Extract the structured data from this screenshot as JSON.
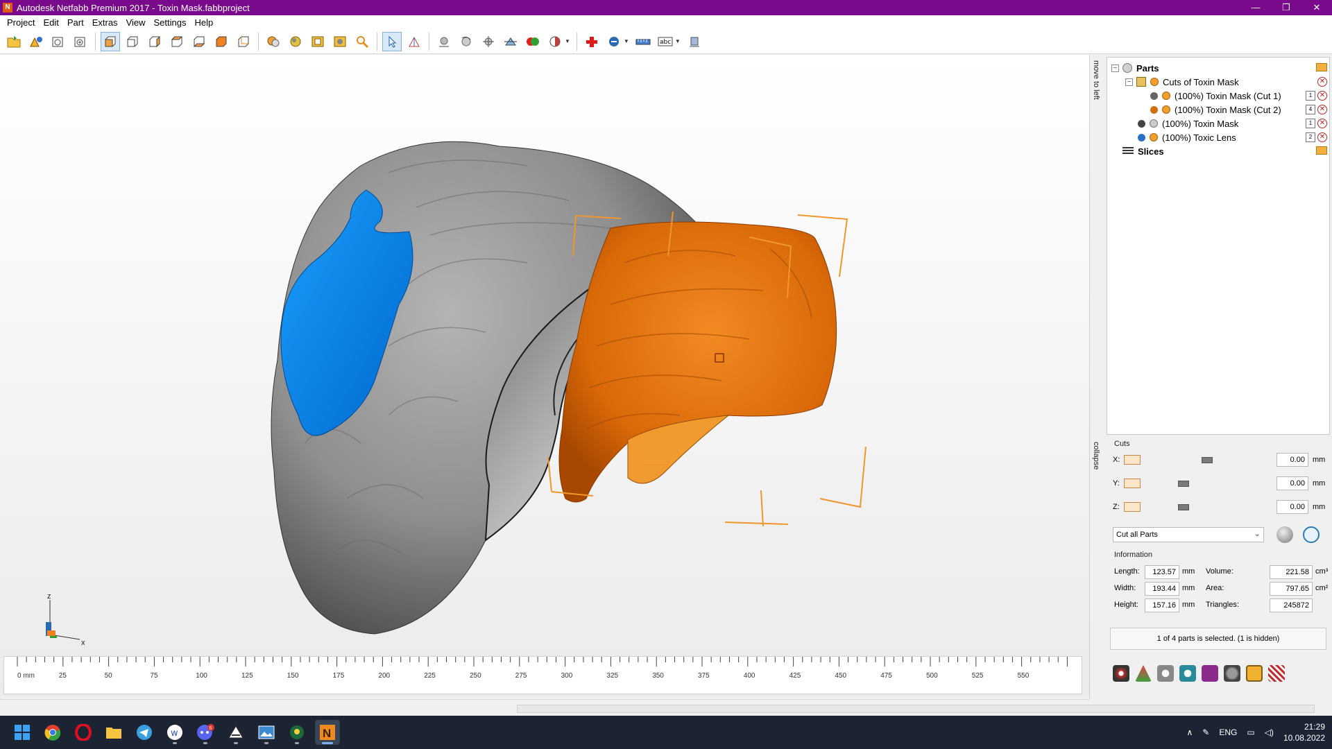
{
  "window": {
    "title": "Autodesk Netfabb Premium 2017 - Toxin Mask.fabbproject",
    "icon_letter": "N",
    "controls": [
      "—",
      "❐",
      "✕"
    ]
  },
  "menu": [
    "Project",
    "Edit",
    "Part",
    "Extras",
    "View",
    "Settings",
    "Help"
  ],
  "side_tabs": {
    "top": "move to left",
    "bottom": "collapse"
  },
  "tree": {
    "parts_label": "Parts",
    "group_label": "Cuts of Toxin Mask",
    "items": [
      {
        "label": "(100%) Toxin Mask (Cut 1)",
        "badge": "1"
      },
      {
        "label": "(100%) Toxin Mask (Cut 2)",
        "badge": "4"
      },
      {
        "label": "(100%) Toxin Mask",
        "badge": "1"
      },
      {
        "label": "(100%) Toxic Lens",
        "badge": "2"
      }
    ],
    "slices_label": "Slices"
  },
  "cuts": {
    "title": "Cuts",
    "rows": [
      {
        "axis": "X:",
        "value": "0.00",
        "unit": "mm"
      },
      {
        "axis": "Y:",
        "value": "0.00",
        "unit": "mm"
      },
      {
        "axis": "Z:",
        "value": "0.00",
        "unit": "mm"
      }
    ],
    "mode": "Cut all Parts"
  },
  "information": {
    "title": "Information",
    "length_label": "Length:",
    "length": "123.57",
    "width_label": "Width:",
    "width": "193.44",
    "height_label": "Height:",
    "height": "157.16",
    "dim_unit": "mm",
    "volume_label": "Volume:",
    "volume": "221.58",
    "volume_unit": "cm³",
    "area_label": "Area:",
    "area": "797.65",
    "area_unit": "cm²",
    "triangles_label": "Triangles:",
    "triangles": "245872"
  },
  "selection_status": "1 of 4 parts is selected. (1 is hidden)",
  "axes": {
    "z": "z",
    "x": "x"
  },
  "ruler": {
    "labels": [
      "0 mm",
      "25",
      "50",
      "75",
      "100",
      "125",
      "150",
      "175",
      "200",
      "225",
      "250",
      "275",
      "300",
      "325",
      "350",
      "375",
      "400",
      "425",
      "450",
      "475",
      "500",
      "525",
      "550"
    ]
  },
  "taskbar": {
    "language": "ENG",
    "time": "21:29",
    "date": "10.08.2022",
    "discord_badge": "6"
  },
  "colors": {
    "titlebar": "#7a0a8c",
    "part_orange": "#e8780c",
    "part_gray": "#8a8a8a",
    "lens_blue": "#0a84f0",
    "bounding_box": "#f0962a"
  }
}
